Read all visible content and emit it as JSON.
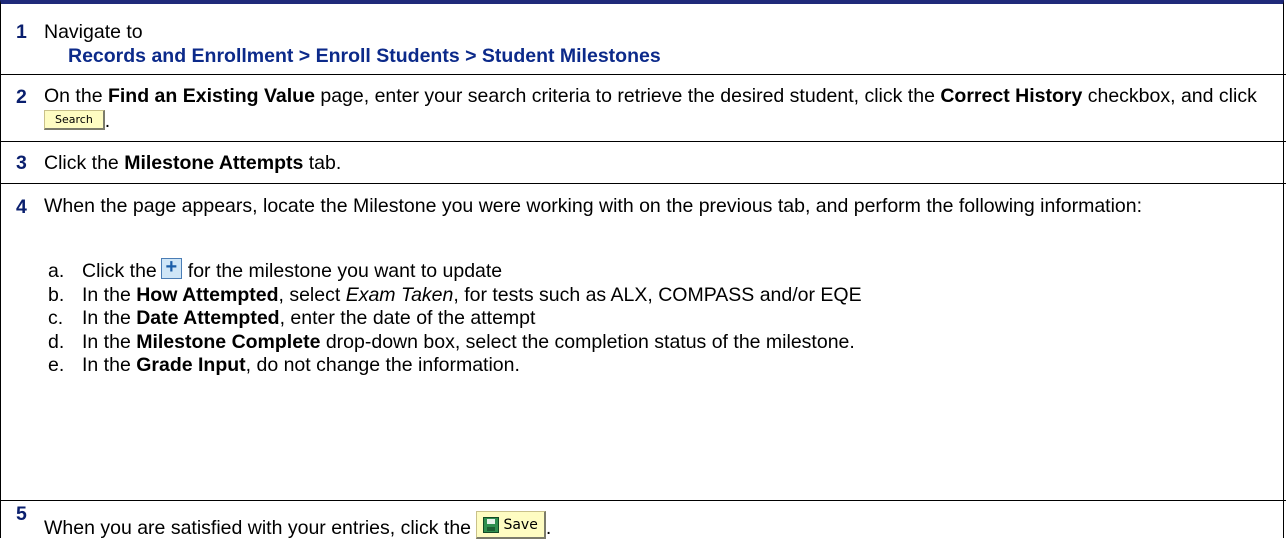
{
  "steps": [
    {
      "num": "1",
      "text": "Navigate to",
      "path": "Records and Enrollment > Enroll Students > Student Milestones"
    },
    {
      "num": "2",
      "part1": "On the ",
      "bold1": "Find an Existing Value",
      "part2": " page, enter your search criteria to retrieve the desired student, click the ",
      "bold2": "Correct History",
      "part3": " checkbox, and click ",
      "button": "Search",
      "part4": "."
    },
    {
      "num": "3",
      "part1": "Click the ",
      "bold1": "Milestone Attempts",
      "part2": " tab."
    },
    {
      "num": "4",
      "intro": "When the page appears, locate the Milestone you were working with on the previous tab, and perform the following information:",
      "items": [
        {
          "letter": "a.",
          "part1": "Click the",
          "part2": "for the milestone you want to update"
        },
        {
          "letter": "b.",
          "part1": "In the ",
          "bold": "How Attempted",
          "part2": ", select ",
          "italic": "Exam Taken",
          "part3": ", for tests such as ALX, COMPASS and/or EQE"
        },
        {
          "letter": "c.",
          "part1": "In the ",
          "bold": "Date Attempted",
          "part2": ", enter the date of the attempt"
        },
        {
          "letter": "d.",
          "part1": "In the ",
          "bold": "Milestone Complete",
          "part2": " drop-down box, select the completion status of the milestone."
        },
        {
          "letter": "e.",
          "part1": "In the ",
          "bold": "Grade Input",
          "part2": ", do not change the information."
        }
      ]
    },
    {
      "num": "5",
      "part1": "When you are satisfied with your entries, click the ",
      "button": "Save",
      "part2": "."
    }
  ],
  "colors": {
    "step_number": "#0a1f6e",
    "nav_path": "#0c2a8a",
    "top_border": "#1f2a7a",
    "button_fill": "#fefcc2"
  },
  "icons": {
    "expand": "plus-icon",
    "save": "save-disk-icon"
  }
}
